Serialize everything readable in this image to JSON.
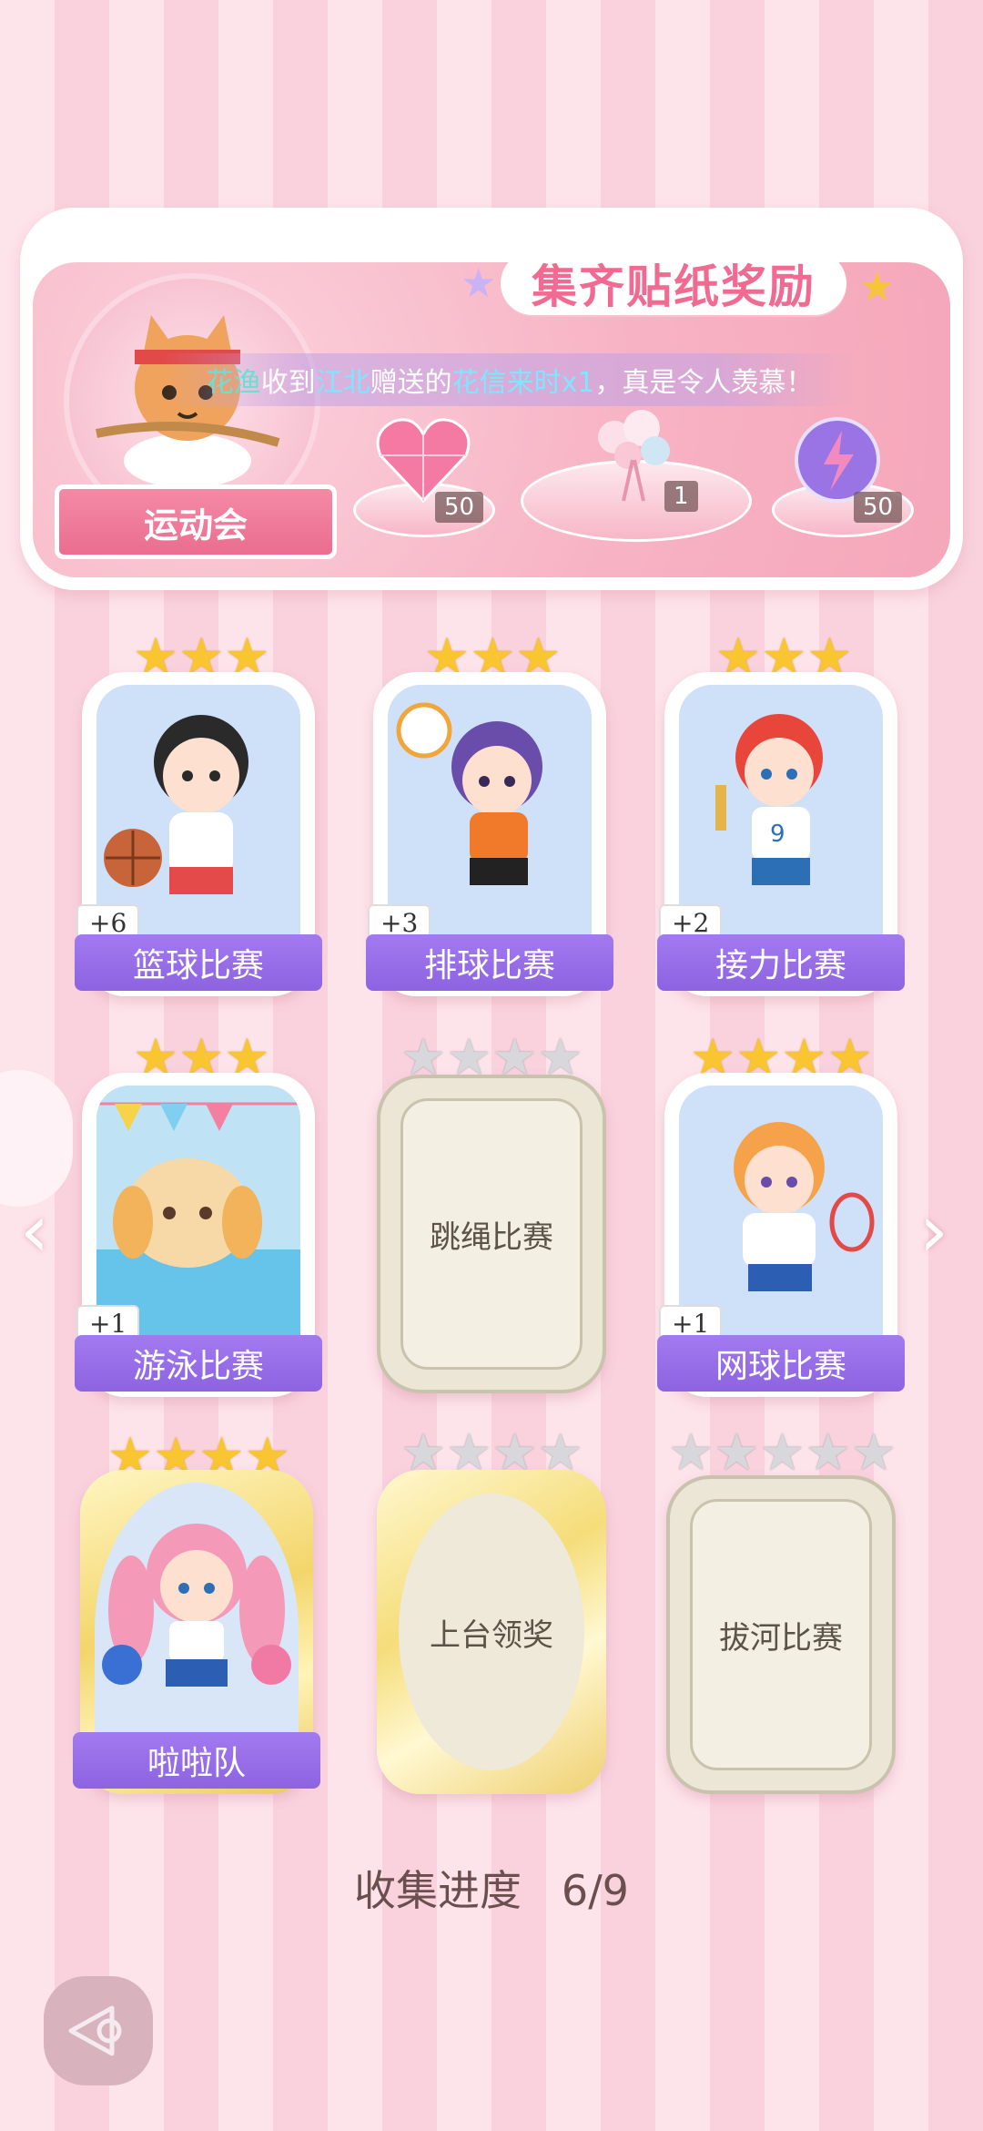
{
  "header": {
    "title": "集齐贴纸奖励",
    "event_label": "运动会",
    "notice": {
      "name1": "花渔",
      "text1": "收到",
      "name2": "江北",
      "text2": "赠送的",
      "item": "花信来时x1",
      "text3": "，真是令人羡慕！"
    },
    "rewards": [
      {
        "icon": "heart-gem-icon",
        "count": "50"
      },
      {
        "icon": "flower-bouquet-icon",
        "count": "1"
      },
      {
        "icon": "energy-orb-icon",
        "count": "50"
      }
    ]
  },
  "cards": [
    {
      "name": "篮球比赛",
      "bonus": "+6",
      "stars_total": 3,
      "stars_lit": 3,
      "state": "collected"
    },
    {
      "name": "排球比赛",
      "bonus": "+3",
      "stars_total": 3,
      "stars_lit": 3,
      "state": "collected"
    },
    {
      "name": "接力比赛",
      "bonus": "+2",
      "stars_total": 3,
      "stars_lit": 3,
      "state": "collected"
    },
    {
      "name": "游泳比赛",
      "bonus": "+1",
      "stars_total": 3,
      "stars_lit": 3,
      "state": "collected"
    },
    {
      "name": "跳绳比赛",
      "stars_total": 4,
      "stars_lit": 0,
      "state": "locked"
    },
    {
      "name": "网球比赛",
      "bonus": "+1",
      "stars_total": 4,
      "stars_lit": 4,
      "state": "collected"
    },
    {
      "name": "啦啦队",
      "stars_total": 4,
      "stars_lit": 4,
      "state": "collected-gold"
    },
    {
      "name": "上台领奖",
      "stars_total": 4,
      "stars_lit": 0,
      "state": "locked-gold"
    },
    {
      "name": "拔河比赛",
      "stars_total": 5,
      "stars_lit": 0,
      "state": "locked"
    }
  ],
  "progress": {
    "label": "收集进度",
    "value": "6/9"
  },
  "colors": {
    "accent": "#f06a92",
    "name_bar": "#9a70ea",
    "star_gold": "#f9c531"
  }
}
